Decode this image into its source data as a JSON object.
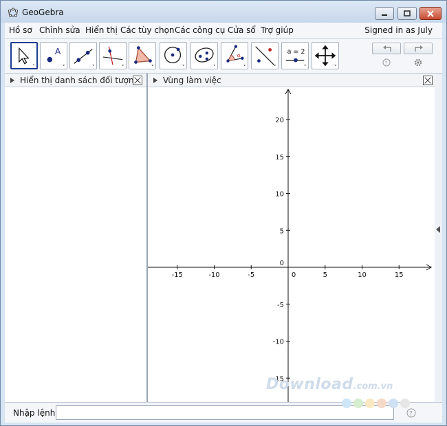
{
  "window": {
    "title": "GeoGebra"
  },
  "menu": {
    "items": [
      "Hồ sơ",
      "Chỉnh sửa",
      "Hiển thị",
      "Các tùy chọn",
      "Các công cụ",
      "Cửa sổ",
      "Trợ giúp"
    ],
    "signed_in": "Signed in as July"
  },
  "toolbar": {
    "tools": [
      "move-tool",
      "point-tool",
      "line-tool",
      "perpendicular-line-tool",
      "polygon-tool",
      "circle-tool",
      "conic-tool",
      "angle-tool",
      "reflect-tool",
      "slider-tool",
      "move-graphics-view-tool"
    ],
    "slider_label": "a = 2",
    "angle_symbol": "α",
    "point_label": "A"
  },
  "algebra": {
    "title": "Hiển thị danh sách đối tượng"
  },
  "graphics": {
    "title": "Vùng làm việc",
    "x_ticks": [
      -15,
      -10,
      -5,
      0,
      5,
      10,
      15
    ],
    "y_ticks": [
      20,
      15,
      10,
      5,
      0,
      -5,
      -10,
      -15
    ],
    "origin_label": "0"
  },
  "input": {
    "label": "Nhập lệnh:",
    "value": ""
  },
  "watermark": {
    "main": "Download",
    "sub": ".com.vn",
    "dot_colors": [
      "#cfe6f7",
      "#d6eed0",
      "#fbe9c3",
      "#f7d9c7",
      "#cfe0f3",
      "#e6e6e6"
    ]
  }
}
